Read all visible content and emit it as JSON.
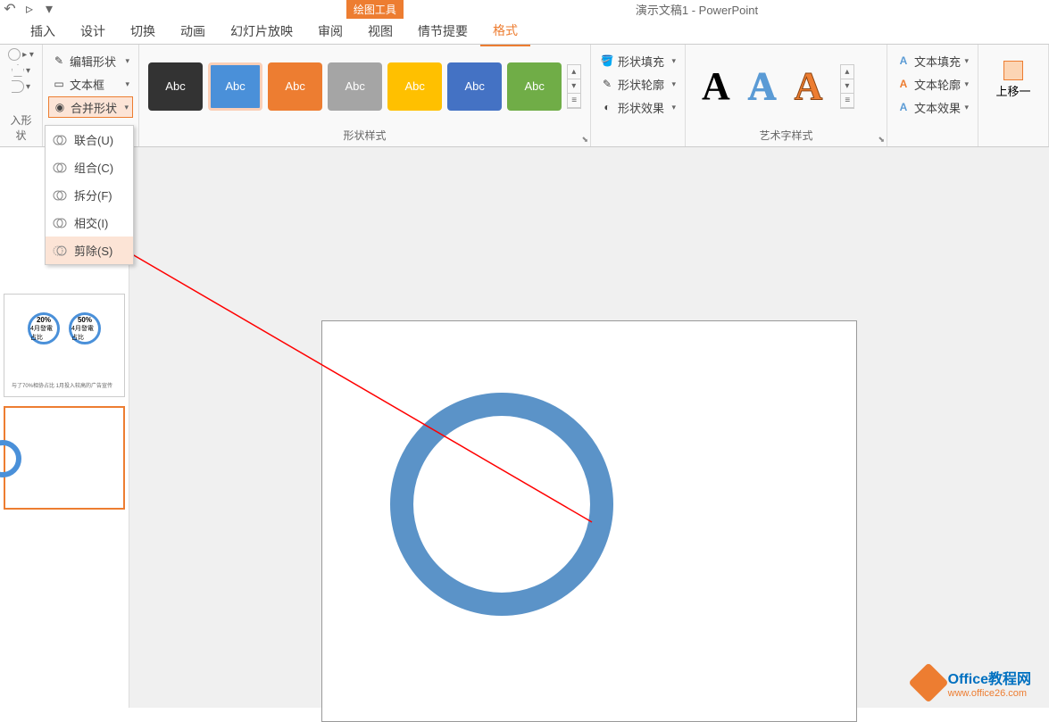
{
  "titleBar": {
    "contextLabel": "绘图工具",
    "appTitle": "演示文稿1 - PowerPoint"
  },
  "tabs": {
    "items": [
      "插入",
      "设计",
      "切换",
      "动画",
      "幻灯片放映",
      "审阅",
      "视图",
      "情节提要",
      "格式"
    ],
    "activeIndex": 8
  },
  "ribbon": {
    "insertShapesLabel": "入形状",
    "editShapeBtn": "编辑形状",
    "textBoxBtn": "文本框",
    "mergeShapesBtn": "合并形状",
    "shapeStylesLabel": "形状样式",
    "styleItemLabel": "Abc",
    "shapeFillBtn": "形状填充",
    "shapeOutlineBtn": "形状轮廓",
    "shapeEffectsBtn": "形状效果",
    "wordArtLabel": "艺术字样式",
    "textFillBtn": "文本填充",
    "textOutlineBtn": "文本轮廓",
    "textEffectsBtn": "文本效果",
    "arrangeBtn": "上移一"
  },
  "mergeMenu": {
    "union": "联合(U)",
    "combine": "组合(C)",
    "fragment": "拆分(F)",
    "intersect": "相交(I)",
    "subtract": "剪除(S)"
  },
  "thumbnails": {
    "circle1": {
      "pct": "20%",
      "label": "4月發電占比"
    },
    "circle2": {
      "pct": "50%",
      "label": "4月發電占比"
    },
    "caption": "与了70%相协占比 1月投入较高的广告宣传"
  },
  "watermark": {
    "text1": "Office教程网",
    "text2": "www.office26.com"
  }
}
